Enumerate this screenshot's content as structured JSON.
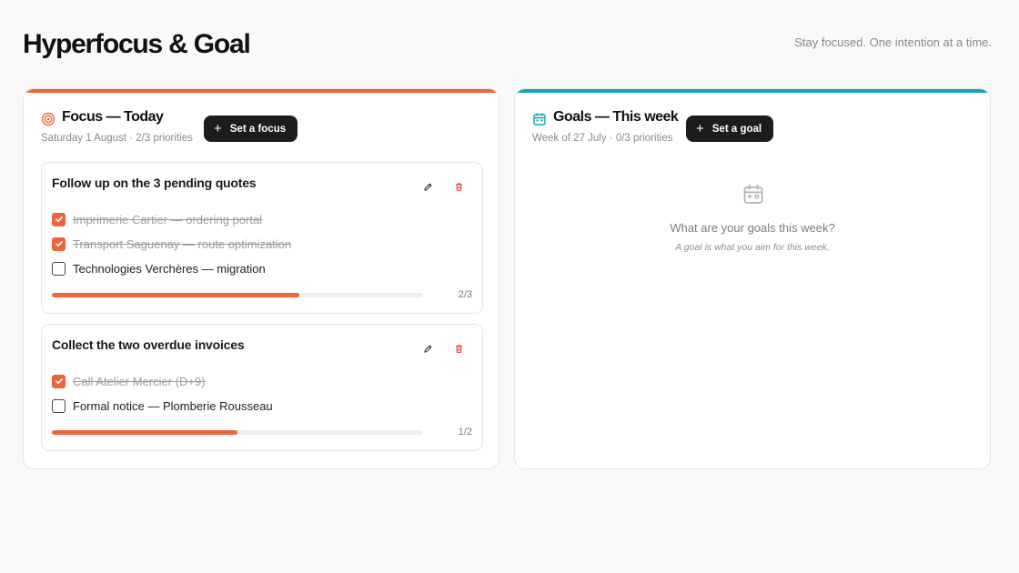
{
  "app": {
    "title": "Hyperfocus & Goal",
    "tagline": "Stay focused. One intention at a time."
  },
  "colors": {
    "focus_accent": "#f0643c",
    "goals_accent": "#14a3b8",
    "button_dark": "#1c1c1c"
  },
  "focus": {
    "icon": "target-icon",
    "title": "Focus — Today",
    "subtitle": "Saturday 1 August · 2/3 priorities",
    "button_label": "Set a focus",
    "priorities": [
      {
        "title": "Follow up on the 3 pending quotes",
        "tasks": [
          {
            "label": "Imprimerie Cartier — ordering portal",
            "done": true
          },
          {
            "label": "Transport Saguenay — route optimization",
            "done": true
          },
          {
            "label": "Technologies Verchères — migration",
            "done": false
          }
        ],
        "progress_text": "2/3",
        "progress": 0.6667
      },
      {
        "title": "Collect the two overdue invoices",
        "tasks": [
          {
            "label": "Call Atelier Mercier (D+9)",
            "done": true
          },
          {
            "label": "Formal notice — Plomberie Rousseau",
            "done": false
          }
        ],
        "progress_text": "1/2",
        "progress": 0.5
      }
    ]
  },
  "goals": {
    "icon": "calendar-icon",
    "title": "Goals — This week",
    "subtitle": "Week of 27 July · 0/3 priorities",
    "button_label": "Set a goal",
    "empty_icon": "calendar-icon",
    "empty_title": "What are your goals this week?",
    "empty_hint": "A goal is what you aim for this week."
  }
}
